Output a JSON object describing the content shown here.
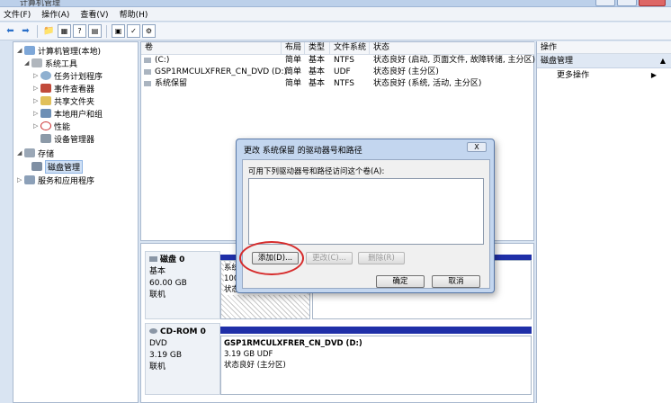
{
  "window": {
    "title": "计算机管理"
  },
  "menu": [
    "文件(F)",
    "操作(A)",
    "查看(V)",
    "帮助(H)"
  ],
  "tree": [
    {
      "label": "计算机管理(本地)",
      "level": 0,
      "arrow": "◢",
      "icon": "computer-icon"
    },
    {
      "label": "系统工具",
      "level": 1,
      "arrow": "◢",
      "icon": "tools-icon"
    },
    {
      "label": "任务计划程序",
      "level": 2,
      "arrow": "▷",
      "icon": "clock-icon"
    },
    {
      "label": "事件查看器",
      "level": 2,
      "arrow": "▷",
      "icon": "event-viewer-icon"
    },
    {
      "label": "共享文件夹",
      "level": 2,
      "arrow": "▷",
      "icon": "folder-icon"
    },
    {
      "label": "本地用户和组",
      "level": 2,
      "arrow": "▷",
      "icon": "users-icon"
    },
    {
      "label": "性能",
      "level": 2,
      "arrow": "▷",
      "icon": "performance-icon"
    },
    {
      "label": "设备管理器",
      "level": 2,
      "arrow": "",
      "icon": "device-manager-icon"
    },
    {
      "label": "存储",
      "level": 0,
      "arrow": "◢",
      "icon": "storage-icon"
    },
    {
      "label": "磁盘管理",
      "level": 1,
      "arrow": "",
      "icon": "disk-management-icon",
      "selected": true
    },
    {
      "label": "服务和应用程序",
      "level": 0,
      "arrow": "▷",
      "icon": "services-icon"
    }
  ],
  "volume_table": {
    "headers": [
      "卷",
      "布局",
      "类型",
      "文件系统",
      "状态"
    ],
    "rows": [
      [
        "(C:)",
        "简单",
        "基本",
        "NTFS",
        "状态良好 (启动, 页面文件, 故障转储, 主分区)"
      ],
      [
        "GSP1RMCULXFRER_CN_DVD (D:)",
        "简单",
        "基本",
        "UDF",
        "状态良好 (主分区)"
      ],
      [
        "系统保留",
        "简单",
        "基本",
        "NTFS",
        "状态良好 (系统, 活动, 主分区)"
      ]
    ]
  },
  "disks": [
    {
      "name": "磁盘 0",
      "type": "基本",
      "size": "60.00 GB",
      "status": "联机",
      "partition": {
        "name": "系统",
        "size": "100",
        "status": "状态"
      }
    },
    {
      "name": "CD-ROM 0",
      "type": "DVD",
      "size": "3.19 GB",
      "status": "联机",
      "partition": {
        "name": "GSP1RMCULXFRER_CN_DVD  (D:)",
        "size": "3.19 GB UDF",
        "status": "状态良好 (主分区)"
      }
    }
  ],
  "actions": {
    "header": "操作",
    "section": "磁盘管理",
    "more": "更多操作"
  },
  "dialog": {
    "title": "更改 系统保留 的驱动器号和路径",
    "label": "可用下列驱动器号和路径访问这个卷(A):",
    "add": "添加(D)...",
    "change": "更改(C)...",
    "remove": "删除(R)",
    "ok": "确定",
    "cancel": "取消",
    "close": "X"
  },
  "colors": {
    "accent_bar": "#1f2fa8",
    "highlight_circle": "#d62a2a"
  }
}
